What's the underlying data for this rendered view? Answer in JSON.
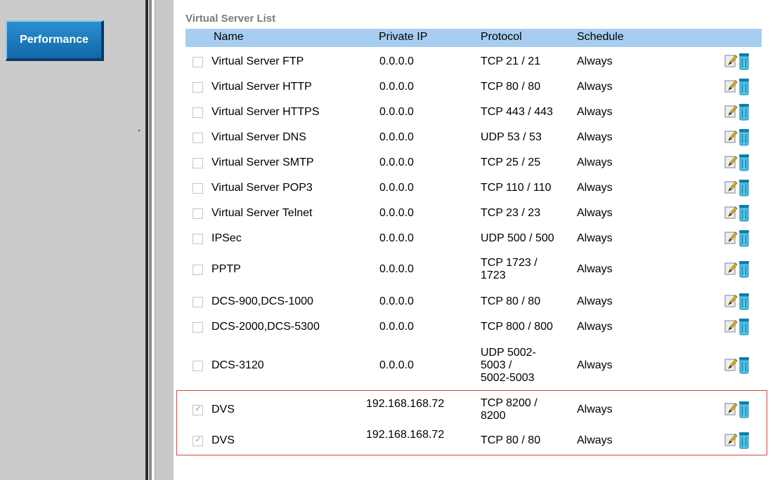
{
  "sidebar": {
    "performance_label": "Performance"
  },
  "list": {
    "title": "Virtual Server List",
    "headers": {
      "name": "Name",
      "private_ip": "Private IP",
      "protocol": "Protocol",
      "schedule": "Schedule"
    },
    "rows": [
      {
        "name": "Virtual Server FTP",
        "ip": "0.0.0.0",
        "protocol": "TCP 21 / 21",
        "schedule": "Always",
        "checked": false
      },
      {
        "name": "Virtual Server HTTP",
        "ip": "0.0.0.0",
        "protocol": "TCP 80 / 80",
        "schedule": "Always",
        "checked": false
      },
      {
        "name": "Virtual Server HTTPS",
        "ip": "0.0.0.0",
        "protocol": "TCP 443 / 443",
        "schedule": "Always",
        "checked": false
      },
      {
        "name": "Virtual Server DNS",
        "ip": "0.0.0.0",
        "protocol": "UDP 53 / 53",
        "schedule": "Always",
        "checked": false
      },
      {
        "name": "Virtual Server SMTP",
        "ip": "0.0.0.0",
        "protocol": "TCP 25 / 25",
        "schedule": "Always",
        "checked": false
      },
      {
        "name": "Virtual Server POP3",
        "ip": "0.0.0.0",
        "protocol": "TCP 110 / 110",
        "schedule": "Always",
        "checked": false
      },
      {
        "name": "Virtual Server Telnet",
        "ip": "0.0.0.0",
        "protocol": "TCP 23 / 23",
        "schedule": "Always",
        "checked": false
      },
      {
        "name": "IPSec",
        "ip": "0.0.0.0",
        "protocol": "UDP 500 / 500",
        "schedule": "Always",
        "checked": false
      },
      {
        "name": "PPTP",
        "ip": "0.0.0.0",
        "protocol": "TCP 1723 / 1723",
        "schedule": "Always",
        "checked": false
      },
      {
        "name": "DCS-900,DCS-1000",
        "ip": "0.0.0.0",
        "protocol": "TCP 80 / 80",
        "schedule": "Always",
        "checked": false
      },
      {
        "name": "DCS-2000,DCS-5300",
        "ip": "0.0.0.0",
        "protocol": "TCP 800 / 800",
        "schedule": "Always",
        "checked": false
      },
      {
        "name": "DCS-3120",
        "ip": "0.0.0.0",
        "protocol": "UDP 5002-5003 / 5002-5003",
        "schedule": "Always",
        "checked": false
      },
      {
        "name": "DVS",
        "ip": "192.168.168.72",
        "protocol": "TCP 8200 / 8200",
        "schedule": "Always",
        "checked": true
      },
      {
        "name": "DVS",
        "ip": "192.168.168.72",
        "protocol": "TCP 80 / 80",
        "schedule": "Always",
        "checked": true
      }
    ]
  },
  "icons": {
    "edit": "edit-icon",
    "delete": "trash-icon"
  },
  "colors": {
    "header_bg": "#a7cdf0",
    "button_blue": "#1a7fc6",
    "highlight_border": "#e04040"
  }
}
